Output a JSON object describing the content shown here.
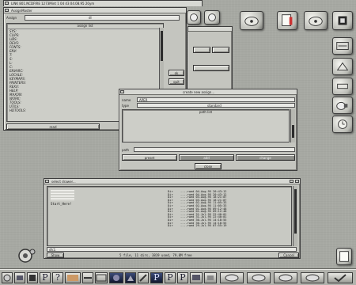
{
  "colors": {
    "desktop": "#a7a9a3",
    "window": "#c4c5bf",
    "list": "#cdcec8",
    "taskbar": "#b2b3ad"
  },
  "top_window": {
    "title": "LINK 801.NCDFIRE 1273Mint 1 04 43 04.08.95 20ym"
  },
  "assign_window": {
    "title": "AssignMaster",
    "device_label": "Assign",
    "device_value": "dl",
    "list_header": "assign list",
    "items": [
      "SYS:",
      "CLIPS:",
      "LIBS:",
      "DEVS:",
      "FONTS:",
      "ENV:",
      "T:",
      "S:",
      "L:",
      "C:",
      "ENVARC:",
      "LOCALE:",
      "KEYMAPS:",
      "PRINTERS:",
      "REXX:",
      "HELP:",
      "MAXON:",
      "WORK:",
      "TOOLS:",
      "UTILS:",
      "HDTOOLS:"
    ],
    "read_label": "read",
    "side_btn_1": "ok",
    "side_btn_2": "quit"
  },
  "create_window": {
    "title": "create new assign...",
    "name_label": "name",
    "name_value": "APER",
    "type_label": "type",
    "type_value": "standard",
    "list_header": "path list",
    "path_label": "path",
    "btn_preset": "preset",
    "btn_add": "add",
    "btn_change": "change",
    "btn_close": "close"
  },
  "output_window": {
    "title": "select drawer...",
    "left_lines": "Start_Here!",
    "mid_column": "Dir\nDir\nDir\nDir\nDir\nDir\nDir\nDir\nDir\nDir\nDir\nDir\nDir\n",
    "cols": "----rwed 04-Aug-95 20:43:12\n----rwed 04-Aug-95 20:43:12\n----rwed 03-Aug-95 18:21:07\n----rwed 03-Aug-95 18:21:07\n----rwed 02-Aug-95 11:05:33\n----rwed 02-Aug-95 11:05:33\n----rwed 01-Aug-95 09:12:48\n----rwed 01-Aug-95 09:12:48\n----rwed 31-Jul-95 22:40:01\n----rwed 31-Jul-95 22:40:01\n----rwed 30-Jul-95 14:18:55\n----rwed 30-Jul-95 14:18:55\n----rwed 29-Jul-95 07:55:19",
    "status": "5 file, 11 dirs, 3819 used, 79.8M free",
    "path_value": "dh1:",
    "show_label": "Show",
    "cancel_label": "Cancel"
  },
  "taskbar": {
    "items": [
      "P",
      "?",
      "P",
      "P",
      "P"
    ]
  }
}
